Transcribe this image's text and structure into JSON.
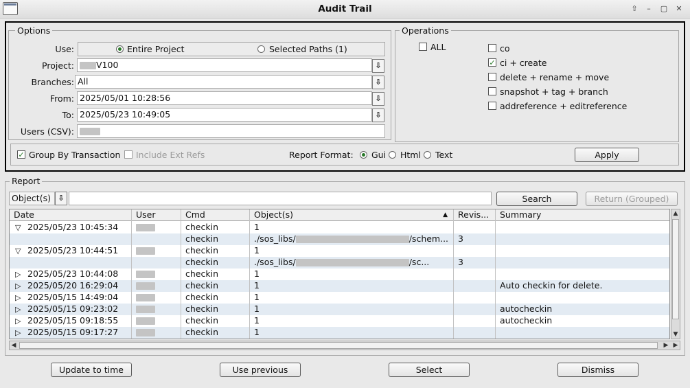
{
  "window": {
    "title": "Audit Trail"
  },
  "options": {
    "legend": "Options",
    "use_label": "Use:",
    "use_entire": "Entire Project",
    "use_selected": "Selected Paths (1)",
    "project_label": "Project:",
    "project_value": "V100",
    "branches_label": "Branches:",
    "branches_value": "All",
    "from_label": "From:",
    "from_value": "2025/05/01 10:28:56",
    "to_label": "To:",
    "to_value": "2025/05/23 10:49:05",
    "users_label": "Users (CSV):",
    "users_value": ""
  },
  "operations": {
    "legend": "Operations",
    "all": "ALL",
    "co": "co",
    "ci_create": "ci + create",
    "delete": "delete + rename + move",
    "snapshot": "snapshot + tag + branch",
    "addref": "addreference + editreference",
    "checked": [
      "ci + create"
    ]
  },
  "bottom_options": {
    "group_by": "Group By Transaction",
    "include_ext": "Include Ext Refs",
    "format_label": "Report Format:",
    "fmt_gui": "Gui",
    "fmt_html": "Html",
    "fmt_text": "Text",
    "selected_format": "Gui",
    "apply": "Apply"
  },
  "report": {
    "legend": "Report",
    "filter_select": "Object(s)",
    "search_value": "",
    "search_button": "Search",
    "return_button": "Return (Grouped)",
    "columns": [
      "Date",
      "User",
      "Cmd",
      "Object(s)",
      "Revis...",
      "Summary"
    ],
    "sort_column": "Object(s)",
    "rows": [
      {
        "expander": "▽",
        "date": "2025/05/23 10:45:34",
        "cmd": "checkin",
        "objects": "1",
        "rev": "",
        "summary": ""
      },
      {
        "expander": "",
        "date": "",
        "cmd": "checkin",
        "objects": "./sos_libs/",
        "objects_tail": "/schem...",
        "rev": "3",
        "summary": ""
      },
      {
        "expander": "▽",
        "date": "2025/05/23 10:44:51",
        "cmd": "checkin",
        "objects": "1",
        "rev": "",
        "summary": ""
      },
      {
        "expander": "",
        "date": "",
        "cmd": "checkin",
        "objects": "./sos_libs/",
        "objects_tail": "/sc...",
        "rev": "3",
        "summary": ""
      },
      {
        "expander": "▷",
        "date": "2025/05/23 10:44:08",
        "cmd": "checkin",
        "objects": "1",
        "rev": "",
        "summary": ""
      },
      {
        "expander": "▷",
        "date": "2025/05/20 16:29:04",
        "cmd": "checkin",
        "objects": "1",
        "rev": "",
        "summary": "Auto checkin for delete."
      },
      {
        "expander": "▷",
        "date": "2025/05/15 14:49:04",
        "cmd": "checkin",
        "objects": "1",
        "rev": "",
        "summary": ""
      },
      {
        "expander": "▷",
        "date": "2025/05/15 09:23:02",
        "cmd": "checkin",
        "objects": "1",
        "rev": "",
        "summary": "autocheckin"
      },
      {
        "expander": "▷",
        "date": "2025/05/15 09:18:55",
        "cmd": "checkin",
        "objects": "1",
        "rev": "",
        "summary": "autocheckin"
      },
      {
        "expander": "▷",
        "date": "2025/05/15 09:17:27",
        "cmd": "checkin",
        "objects": "1",
        "rev": "",
        "summary": ""
      }
    ]
  },
  "footer": {
    "update": "Update to time",
    "previous": "Use previous",
    "select": "Select",
    "dismiss": "Dismiss"
  },
  "colors": {
    "row_alt": "#e3ebf3",
    "check_green": "#2a7a2a"
  }
}
